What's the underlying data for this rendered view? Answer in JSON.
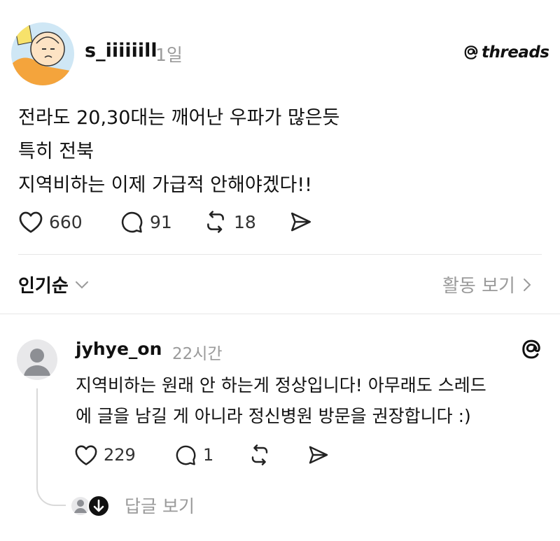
{
  "post": {
    "username": "s_iiiiiill",
    "time": "1일",
    "brand": "threads",
    "lines": [
      "전라도 20,30대는  깨어난 우파가 많은듯",
      "특히 전북",
      "지역비하는 이제 가급적 안해야겠다!!"
    ],
    "likes": "660",
    "comments": "91",
    "reposts": "18"
  },
  "sort": {
    "label": "인기순",
    "activity": "활동 보기"
  },
  "reply": {
    "username": "jyhye_on",
    "time": "22시간",
    "lines": [
      "지역비하는 원래 안 하는게 정상입니다! 아무래도 스레드",
      "에 글을 남길 게 아니라 정신병원 방문을 권장합니다 :)"
    ],
    "likes": "229",
    "comments": "1",
    "view_replies": "답글 보기"
  },
  "icons": {
    "heart": "heart-icon",
    "comment": "comment-icon",
    "repost": "repost-icon",
    "share": "share-icon",
    "threads_logo": "threads-logo-icon"
  },
  "colors": {
    "text": "#111111",
    "muted": "#9a9a9a",
    "divider": "#e6e6e6",
    "avatar_bg": "#cfe7f5"
  }
}
